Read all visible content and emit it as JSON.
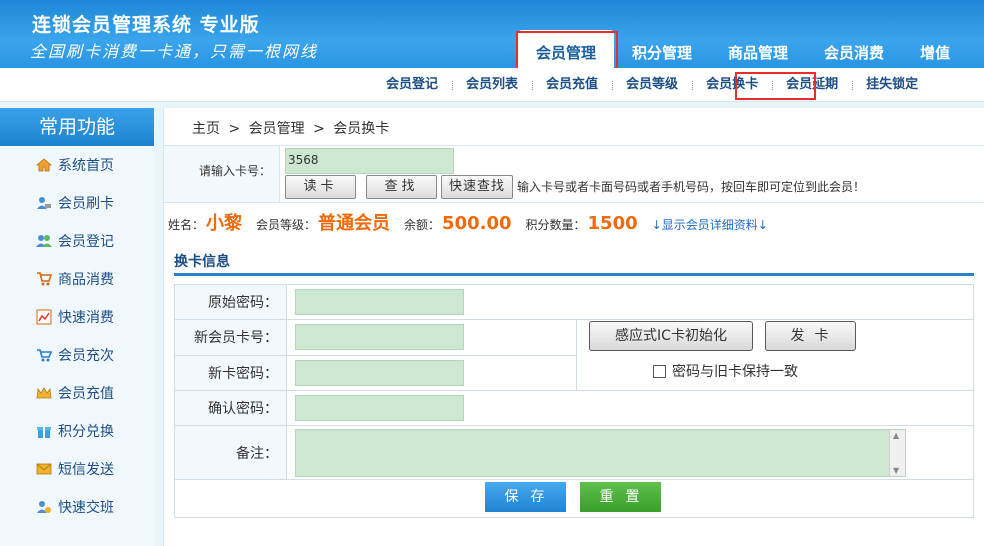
{
  "app": {
    "title": "连锁会员管理系统 专业版",
    "slogan": "全国刷卡消费一卡通，只需一根网线"
  },
  "top_nav": [
    "会员管理",
    "积分管理",
    "商品管理",
    "会员消费",
    "增值"
  ],
  "sub_nav": [
    "会员登记",
    "会员列表",
    "会员充值",
    "会员等级",
    "会员换卡",
    "会员延期",
    "挂失锁定"
  ],
  "sidebar": {
    "title": "常用功能",
    "items": [
      {
        "label": "系统首页",
        "icon": "home-icon"
      },
      {
        "label": "会员刷卡",
        "icon": "member-card-icon"
      },
      {
        "label": "会员登记",
        "icon": "member-register-icon"
      },
      {
        "label": "商品消费",
        "icon": "shopping-cart-icon"
      },
      {
        "label": "快速消费",
        "icon": "chart-icon"
      },
      {
        "label": "会员充次",
        "icon": "cart-count-icon"
      },
      {
        "label": "会员充值",
        "icon": "crown-icon"
      },
      {
        "label": "积分兑换",
        "icon": "gift-icon"
      },
      {
        "label": "短信发送",
        "icon": "mail-icon"
      },
      {
        "label": "快速交班",
        "icon": "handover-icon"
      }
    ]
  },
  "breadcrumb": [
    "主页",
    ">",
    "会员管理",
    ">",
    "会员换卡"
  ],
  "card_search": {
    "label": "请输入卡号：",
    "value": "3568",
    "read_button": "读卡",
    "find_button": "查找",
    "quick_find_button": "快速查找",
    "hint": "输入卡号或者卡面号码或者手机号码，按回车即可定位到此会员！"
  },
  "member": {
    "name_label": "姓名：",
    "name": "小黎",
    "level_label": "会员等级：",
    "level": "普通会员",
    "balance_label": "余额：",
    "balance": "500.00",
    "points_label": "积分数量：",
    "points": "1500",
    "detail_link": "↓显示会员详细资料↓"
  },
  "section_title": "换卡信息",
  "form": {
    "original_password": "原始密码：",
    "new_card_no": "新会员卡号：",
    "new_card_password": "新卡密码：",
    "confirm_password": "确认密码：",
    "remark": "备注：",
    "ic_init_button": "感应式IC卡初始化",
    "issue_card_button": "发卡",
    "same_password_checkbox": "密码与旧卡保持一致"
  },
  "buttons": {
    "save": "保存",
    "reset": "重置"
  },
  "colors": {
    "brand_blue": "#2a95e2",
    "highlight_red": "#e62e2e",
    "value_orange": "#f06a0e",
    "input_green": "#cde8d0"
  }
}
